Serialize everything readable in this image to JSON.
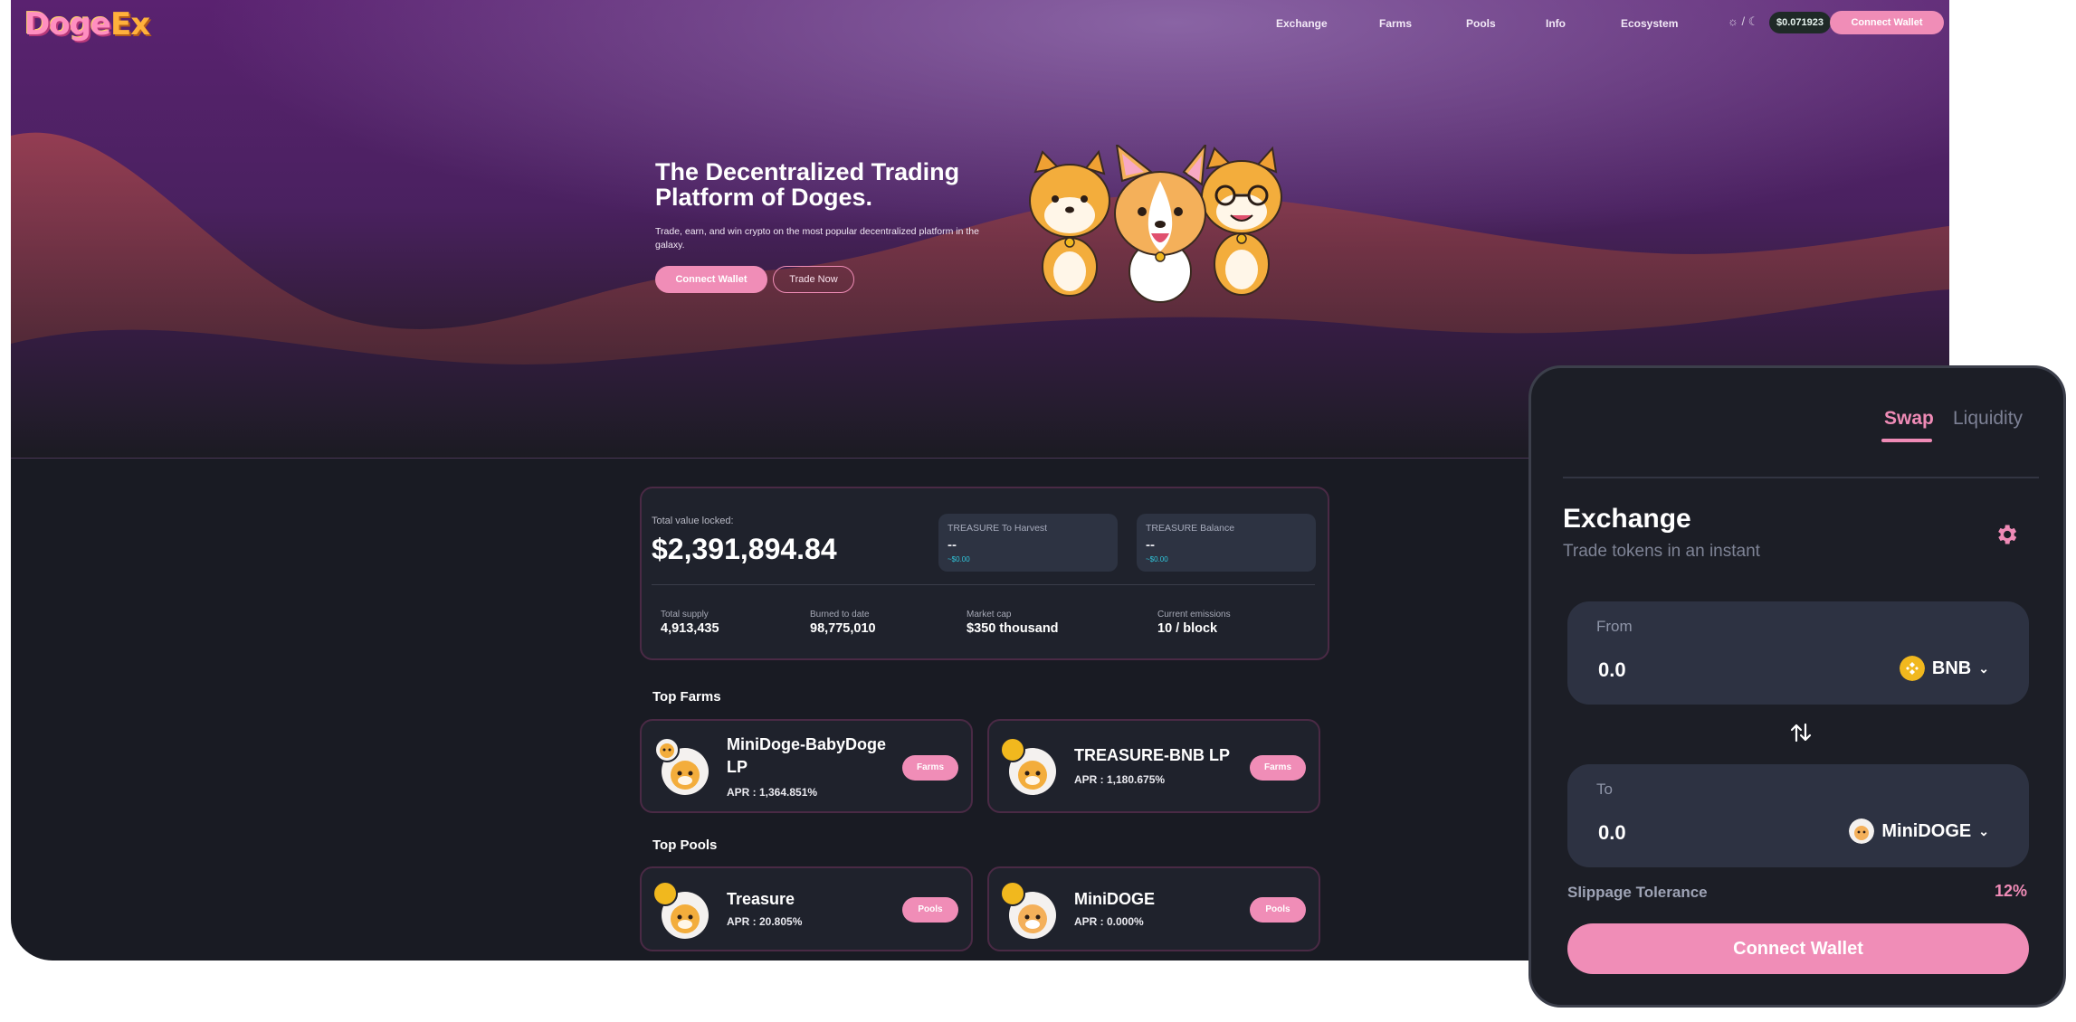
{
  "nav": {
    "logo_main": "Doge",
    "logo_accent": "Ex",
    "links": [
      "Exchange",
      "Farms",
      "Pools",
      "Info",
      "Ecosystem"
    ],
    "theme_toggle": "☼ / ☾",
    "price": "$0.071923",
    "connect_label": "Connect Wallet"
  },
  "hero": {
    "title": "The Decentralized Trading Platform of Doges.",
    "subtitle": "Trade, earn, and win crypto on the most popular decentralized platform in the galaxy.",
    "connect_label": "Connect Wallet",
    "trade_label": "Trade Now"
  },
  "stats": {
    "tvl_label": "Total value locked:",
    "tvl_value": "$2,391,894.84",
    "harvest": {
      "title": "TREASURE To Harvest",
      "value": "--",
      "usd": "~$0.00"
    },
    "balance": {
      "title": "TREASURE Balance",
      "value": "--",
      "usd": "~$0.00"
    },
    "items": [
      {
        "label": "Total supply",
        "value": "4,913,435"
      },
      {
        "label": "Burned to date",
        "value": "98,775,010"
      },
      {
        "label": "Market cap",
        "value": "$350 thousand"
      },
      {
        "label": "Current emissions",
        "value": "10 / block"
      }
    ]
  },
  "top_farms": {
    "title": "Top Farms",
    "items": [
      {
        "name": "MiniDoge-BabyDoge LP",
        "apr": "APR : 1,364.851%",
        "action": "Farms"
      },
      {
        "name": "TREASURE-BNB LP",
        "apr": "APR : 1,180.675%",
        "action": "Farms"
      }
    ]
  },
  "top_pools": {
    "title": "Top Pools",
    "items": [
      {
        "name": "Treasure",
        "apr": "APR : 20.805%",
        "action": "Pools"
      },
      {
        "name": "MiniDOGE",
        "apr": "APR : 0.000%",
        "action": "Pools"
      }
    ]
  },
  "exchange": {
    "tabs": [
      "Swap",
      "Liquidity"
    ],
    "title": "Exchange",
    "subtitle": "Trade tokens in an instant",
    "from": {
      "label": "From",
      "amount": "0.0",
      "token": "BNB"
    },
    "to": {
      "label": "To",
      "amount": "0.0",
      "token": "MiniDOGE"
    },
    "slippage_label": "Slippage Tolerance",
    "slippage_value": "12%",
    "connect_label": "Connect Wallet"
  },
  "colors": {
    "accent": "#f08db7",
    "panel": "#1c1e26",
    "card": "#1f222c",
    "bnb": "#f1b81e"
  },
  "icons": [
    "sun-icon",
    "moon-icon",
    "settings-gear-icon",
    "swap-arrows-icon",
    "bnb-coin-icon",
    "chevron-down-icon"
  ]
}
